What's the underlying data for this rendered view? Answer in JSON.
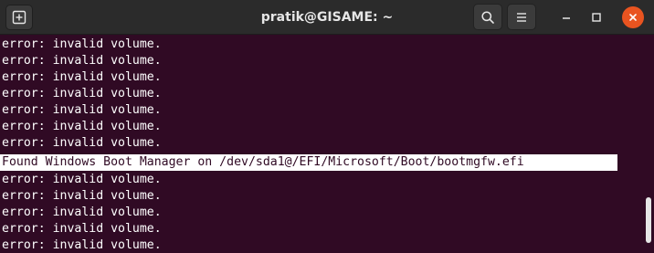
{
  "window": {
    "title": "pratik@GISAME: ~",
    "icons": {
      "new_tab": "new-tab-icon",
      "search": "search-icon",
      "menu": "hamburger-menu-icon",
      "minimize": "minimize-icon",
      "maximize": "maximize-icon",
      "close": "close-icon"
    },
    "colors": {
      "terminal_background": "#300a24",
      "terminal_text": "#ffffff",
      "titlebar": "#2b2b2b",
      "close_button": "#e95420",
      "selection_background": "#ffffff"
    }
  },
  "terminal": {
    "lines": [
      "error: invalid volume.",
      "error: invalid volume.",
      "error: invalid volume.",
      "error: invalid volume.",
      "error: invalid volume.",
      "error: invalid volume.",
      "error: invalid volume.",
      "Found Windows Boot Manager on /dev/sda1@/EFI/Microsoft/Boot/bootmgfw.efi",
      "error: invalid volume.",
      "error: invalid volume.",
      "error: invalid volume.",
      "error: invalid volume.",
      "error: invalid volume."
    ],
    "highlighted_line_index": 7
  }
}
